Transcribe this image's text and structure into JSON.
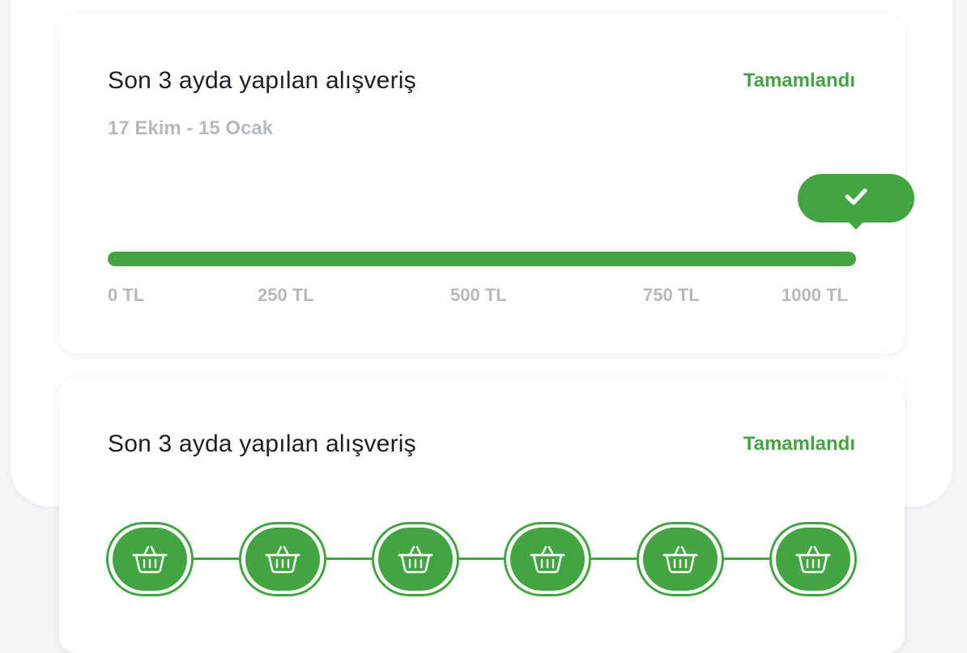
{
  "cards": [
    {
      "title": "Son 3 ayda yapılan alışveriş",
      "status": "Tamamlandı",
      "date_range": "17 Ekim - 15 Ocak",
      "progress_fraction": 1.0,
      "ticks": [
        "0 TL",
        "250 TL",
        "500 TL",
        "750 TL",
        "1000 TL"
      ],
      "bubble_icon": "check-icon"
    },
    {
      "title": "Son 3 ayda yapılan alışveriş",
      "status": "Tamamlandı",
      "steps_total": 6,
      "steps_completed": 6,
      "step_icon": "basket-icon"
    }
  ],
  "colors": {
    "accent": "#43a541",
    "title": "#1b1f2a",
    "muted": "#b4b8bf",
    "background": "#f4f5f9",
    "card": "#ffffff"
  }
}
